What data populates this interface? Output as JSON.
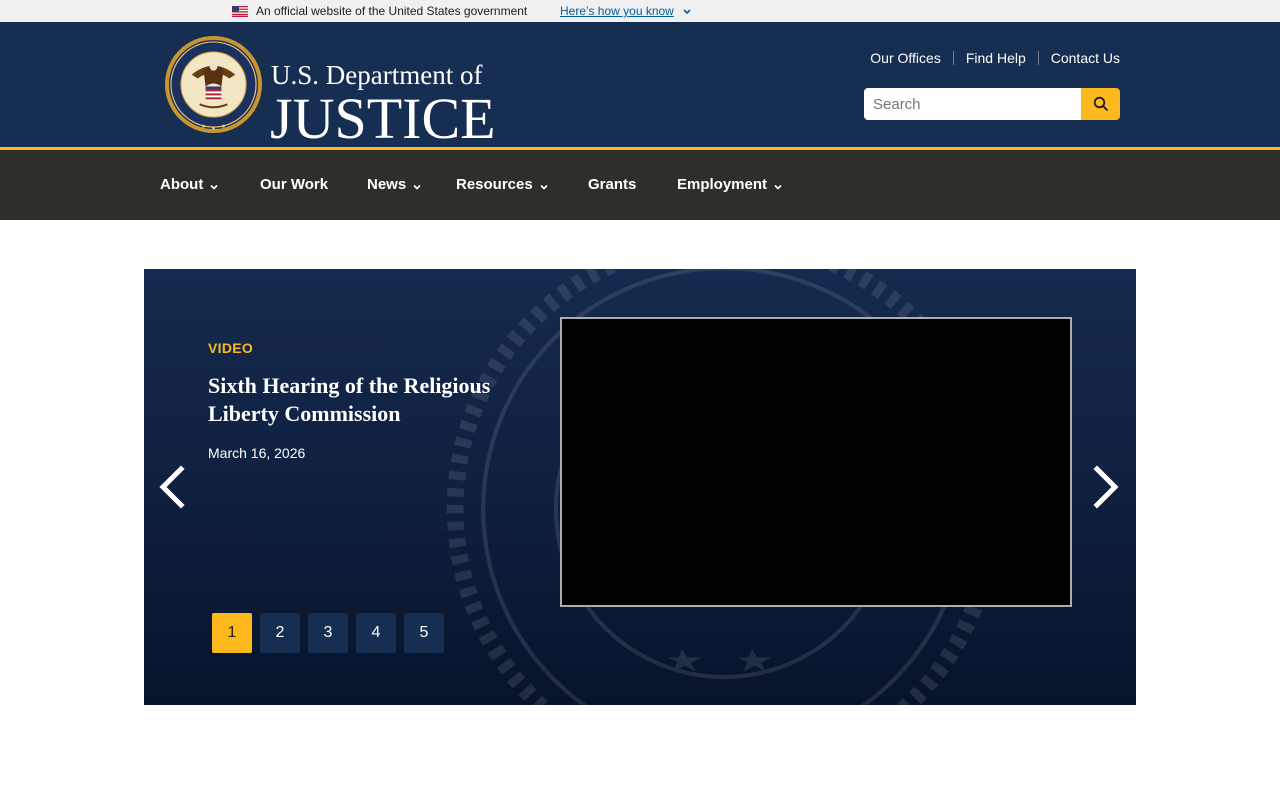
{
  "gov_banner": {
    "official_text": "An official website of the United States government",
    "how_link": "Here’s how you know"
  },
  "header": {
    "wordmark_top": "U.S. Department of",
    "wordmark_bottom": "JUSTICE",
    "utility_links": [
      "Our Offices",
      "Find Help",
      "Contact Us"
    ],
    "search": {
      "placeholder": "Search"
    }
  },
  "nav": {
    "items": [
      {
        "label": "About",
        "dropdown": true
      },
      {
        "label": "Our Work",
        "dropdown": false
      },
      {
        "label": "News",
        "dropdown": true
      },
      {
        "label": "Resources",
        "dropdown": true
      },
      {
        "label": "Grants",
        "dropdown": false
      },
      {
        "label": "Employment",
        "dropdown": true
      }
    ]
  },
  "hero": {
    "tag": "VIDEO",
    "title": "Sixth Hearing of the Religious Liberty Commission",
    "date": "March 16, 2026",
    "pages": [
      "1",
      "2",
      "3",
      "4",
      "5"
    ],
    "active_page": "1"
  },
  "colors": {
    "header_bg": "#162e51",
    "nav_bg": "#2f2f2a",
    "accent": "#fdb81e",
    "link": "#005ea2"
  }
}
